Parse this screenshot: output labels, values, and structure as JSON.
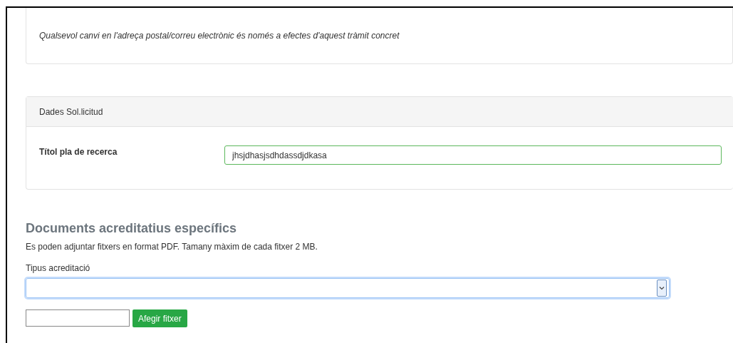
{
  "notice": {
    "text": "Qualsevol canvi en l'adreça postal/correu electrònic és només a efectes d'aquest tràmit concret"
  },
  "request_panel": {
    "title": "Dades Sol.licitud",
    "field": {
      "label": "Títol pla de recerca",
      "value": "jhsjdhasjsdhdassdjdkasa",
      "valid": true
    }
  },
  "documents": {
    "heading": "Documents acreditatius específics",
    "description": "Es poden adjuntar fitxers en format PDF. Tamany màxim de cada fitxer 2 MB.",
    "select_label": "Tipus acreditació",
    "select_focused": true,
    "add_button": "Afegir fitxer"
  }
}
